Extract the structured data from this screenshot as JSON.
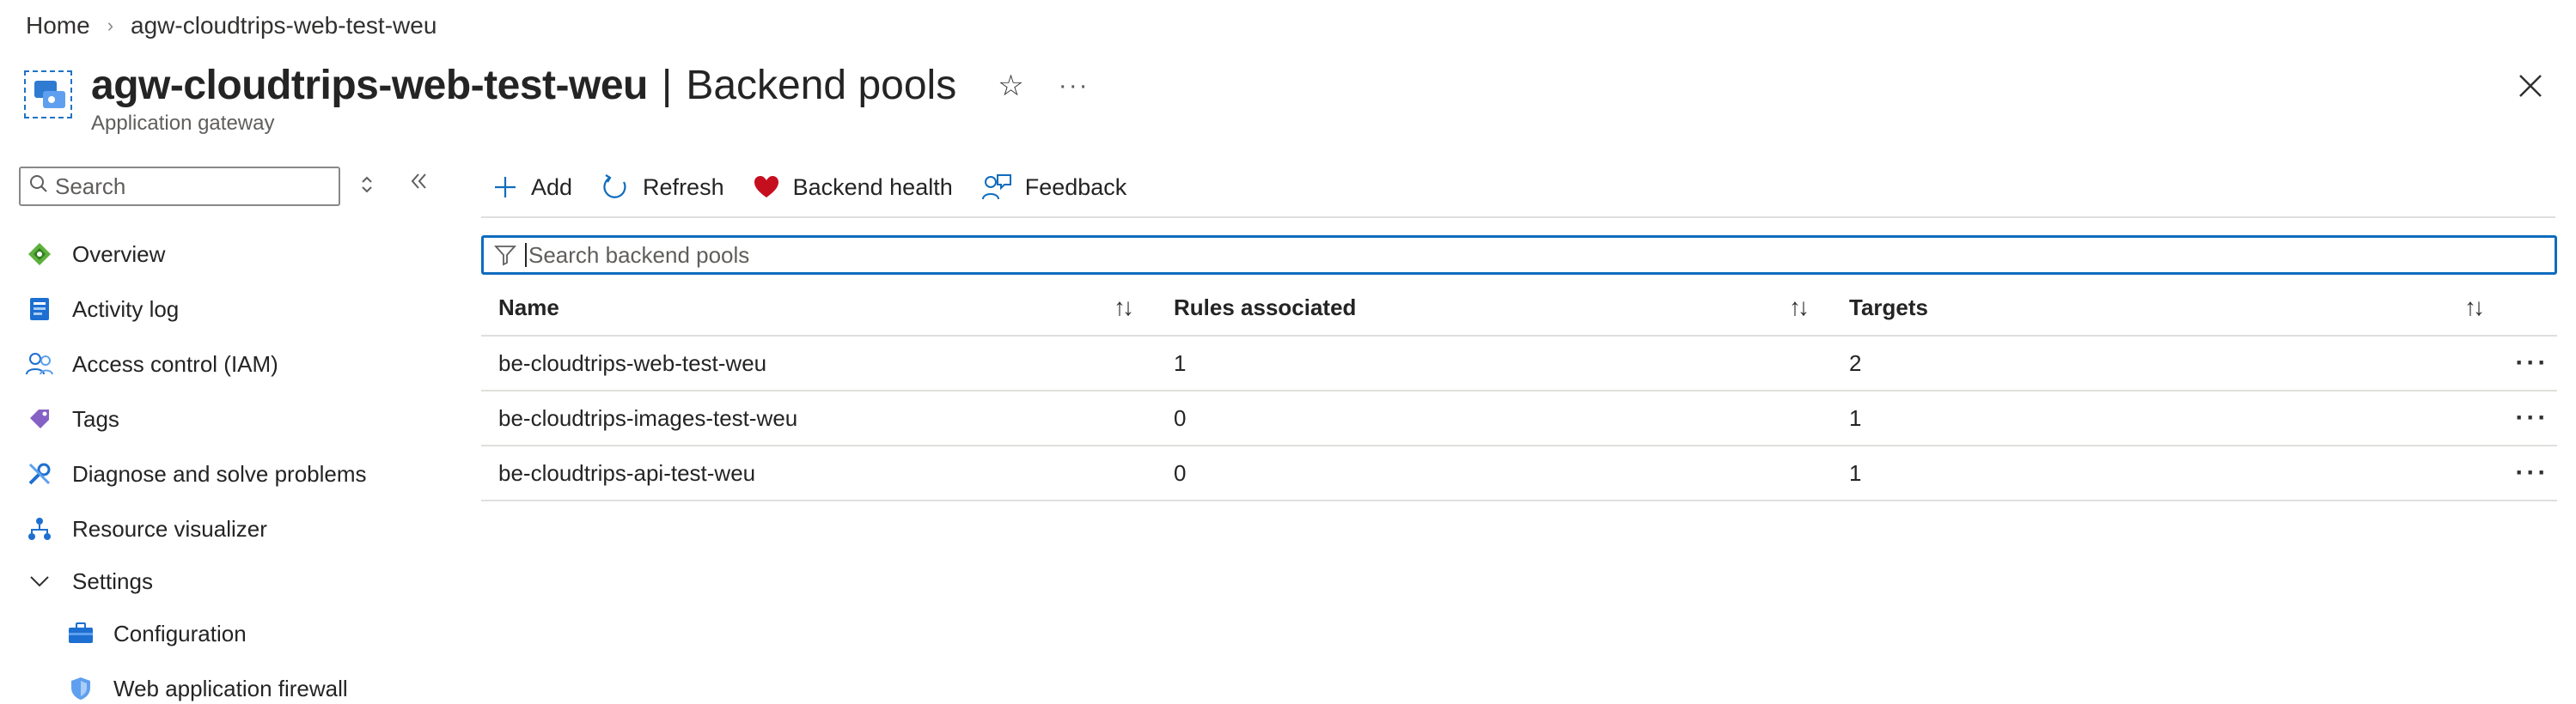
{
  "breadcrumb": {
    "home": "Home",
    "current": "agw-cloudtrips-web-test-weu"
  },
  "header": {
    "resource_name": "agw-cloudtrips-web-test-weu",
    "separator": "|",
    "blade_name": "Backend pools",
    "subtitle": "Application gateway",
    "star_icon": "star-icon",
    "more_icon": "more-icon",
    "close_icon": "close-icon"
  },
  "nav": {
    "search_placeholder": "Search",
    "items": [
      {
        "label": "Overview",
        "icon": "overview-icon"
      },
      {
        "label": "Activity log",
        "icon": "activity-log-icon"
      },
      {
        "label": "Access control (IAM)",
        "icon": "iam-icon"
      },
      {
        "label": "Tags",
        "icon": "tag-icon"
      },
      {
        "label": "Diagnose and solve problems",
        "icon": "wrench-icon"
      },
      {
        "label": "Resource visualizer",
        "icon": "visualizer-icon"
      },
      {
        "label": "Settings",
        "icon": "chevron-down-icon"
      },
      {
        "label": "Configuration",
        "icon": "configuration-icon"
      },
      {
        "label": "Web application firewall",
        "icon": "shield-icon"
      }
    ]
  },
  "toolbar": {
    "add": "Add",
    "refresh": "Refresh",
    "backend_health": "Backend health",
    "feedback": "Feedback"
  },
  "filter": {
    "placeholder": "Search backend pools"
  },
  "table": {
    "columns": [
      "Name",
      "Rules associated",
      "Targets"
    ],
    "rows": [
      {
        "name": "be-cloudtrips-web-test-weu",
        "rules": "1",
        "targets": "2"
      },
      {
        "name": "be-cloudtrips-images-test-weu",
        "rules": "0",
        "targets": "1"
      },
      {
        "name": "be-cloudtrips-api-test-weu",
        "rules": "0",
        "targets": "1"
      }
    ]
  },
  "colors": {
    "accent": "#0f6cbd",
    "heart": "#c50f1f",
    "border": "#e1dfdd"
  }
}
